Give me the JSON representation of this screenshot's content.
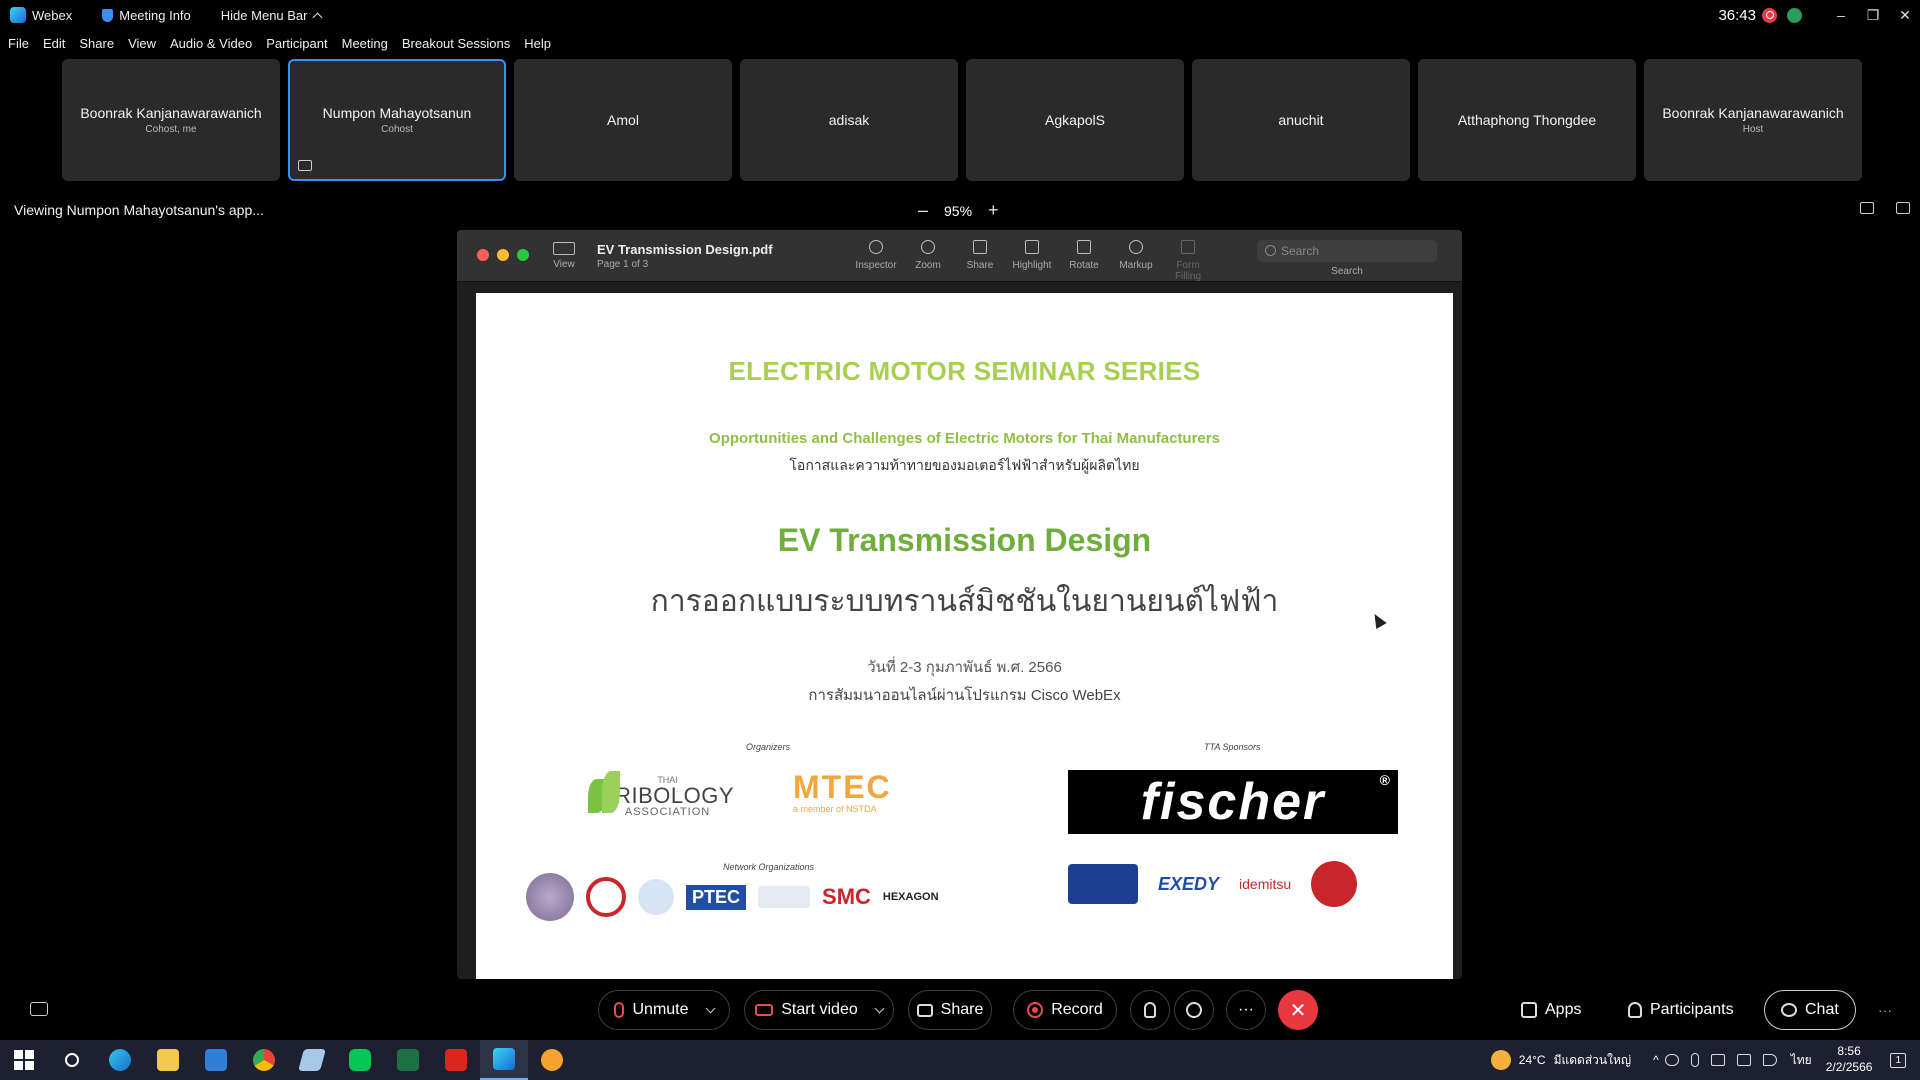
{
  "app": {
    "name": "Webex",
    "meeting_info": "Meeting Info",
    "hide_menu": "Hide Menu Bar",
    "timer": "36:43",
    "window_controls": [
      "–",
      "❐",
      "✕"
    ]
  },
  "menu": [
    "File",
    "Edit",
    "Share",
    "View",
    "Audio & Video",
    "Participant",
    "Meeting",
    "Breakout Sessions",
    "Help"
  ],
  "participants": [
    {
      "name": "Boonrak Kanjanawarawanich",
      "role": "Cohost, me"
    },
    {
      "name": "Numpon Mahayotsanun",
      "role": "Cohost"
    },
    {
      "name": "Amol",
      "role": ""
    },
    {
      "name": "adisak",
      "role": ""
    },
    {
      "name": "AgkapolS",
      "role": ""
    },
    {
      "name": "anuchit",
      "role": ""
    },
    {
      "name": "Atthaphong Thongdee",
      "role": ""
    },
    {
      "name": "Boonrak Kanjanawarawanich",
      "role": "Host"
    }
  ],
  "share_view": {
    "viewing_label": "Viewing Numpon Mahayotsanun's app...",
    "zoom_level": "95%",
    "zoom_minus": "–",
    "zoom_plus": "+"
  },
  "pdf": {
    "title": "EV Transmission Design.pdf",
    "page_info": "Page 1 of 3",
    "view_label": "View",
    "tools": [
      "Inspector",
      "Zoom",
      "Share",
      "Highlight",
      "Rotate",
      "Markup",
      "Form Filling"
    ],
    "search_placeholder": "Search",
    "search_label": "Search",
    "page": {
      "series": "ELECTRIC MOTOR SEMINAR SERIES",
      "subtitle_en": "Opportunities and Challenges of Electric Motors for Thai Manufacturers",
      "subtitle_th": "โอกาสและความท้าทายของมอเตอร์ไฟฟ้าสำหรับผู้ผลิตไทย",
      "title": "EV Transmission Design",
      "title_th": "การออกแบบระบบทรานส์มิชชันในยานยนต์ไฟฟ้า",
      "date": "วันที่ 2-3 กุมภาพันธ์ พ.ศ. 2566",
      "online": "การสัมมนาออนไลน์ผ่านโปรแกรม Cisco WebEx",
      "organizers_label": "Organizers",
      "sponsors_label": "TTA Sponsors",
      "network_label": "Network Organizations",
      "tribology": {
        "small": "THAI",
        "main": "TRIBOLOGY",
        "sub": "ASSOCIATION"
      },
      "mtec": {
        "main": "MTEC",
        "sub": "a member of NSTDA"
      },
      "fischer": "fischer",
      "fischer_reg": "®",
      "network_logos": [
        "PTEC",
        "SMC",
        "HEXAGON"
      ],
      "sponsor_logos": [
        "EXEDY",
        "idemitsu"
      ]
    }
  },
  "controls": {
    "unmute": "Unmute",
    "start_video": "Start video",
    "share": "Share",
    "record": "Record",
    "more": "···",
    "end": "✕",
    "apps": "Apps",
    "participants": "Participants",
    "chat": "Chat",
    "overflow": "···"
  },
  "taskbar": {
    "weather": "24°C",
    "location": "มีแดดส่วนใหญ่",
    "lang": "ไทย",
    "time": "8:56",
    "date": "2/2/2566",
    "tray_chevron": "^",
    "notif_count": "1"
  },
  "colors": {
    "accent": "#3a8ef6",
    "danger": "#e8383e",
    "seminar_green": "#a8cf52",
    "title_green": "#6fae3c"
  }
}
